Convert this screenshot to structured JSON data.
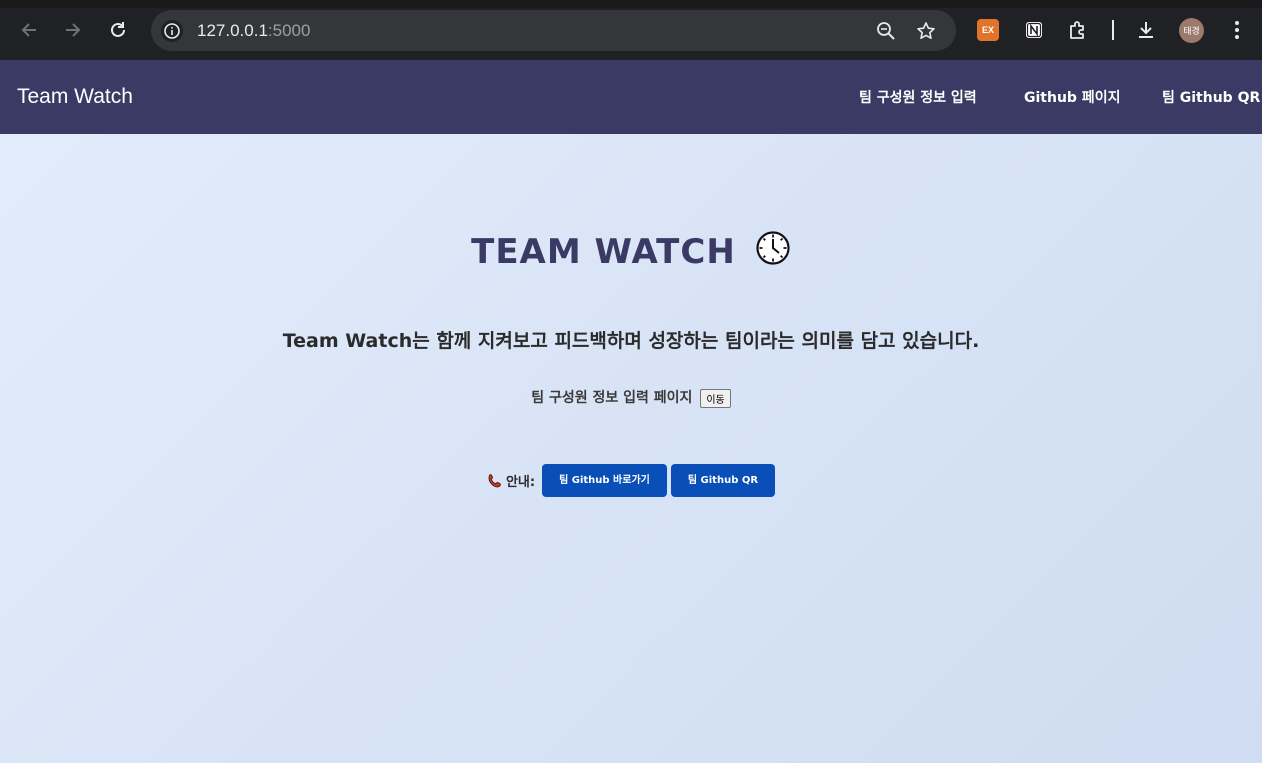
{
  "browser": {
    "url_host": "127.0.0.1",
    "url_port": ":5000",
    "avatar_text": "태경",
    "ext_ex_label": "EX",
    "icons": [
      "back-arrow-icon",
      "forward-arrow-icon",
      "reload-icon",
      "site-info-icon",
      "zoom-icon",
      "bookmark-star-icon",
      "ex-extension-icon",
      "notion-icon",
      "extensions-puzzle-icon",
      "download-icon",
      "menu-kebab-icon"
    ]
  },
  "navbar": {
    "brand": "Team Watch",
    "links": [
      "팀 구성원 정보 입력",
      "Github 페이지",
      "팀 Github QR"
    ],
    "bg_color": "#3a3a64"
  },
  "hero": {
    "title": "TEAM WATCH",
    "title_icon": "clock-icon",
    "subtitle": "Team Watch는 함께 지켜보고 피드백하며 성장하는 팀이라는 의미를 담고 있습니다."
  },
  "member_info": {
    "label": "팀 구성원 정보 입력 페이지",
    "button": "이동"
  },
  "guide": {
    "icon": "phone-icon",
    "label": "안내:",
    "buttons": [
      "팀 Github 바로가기",
      "팀 Github QR"
    ],
    "button_color": "#0a4fb8"
  }
}
